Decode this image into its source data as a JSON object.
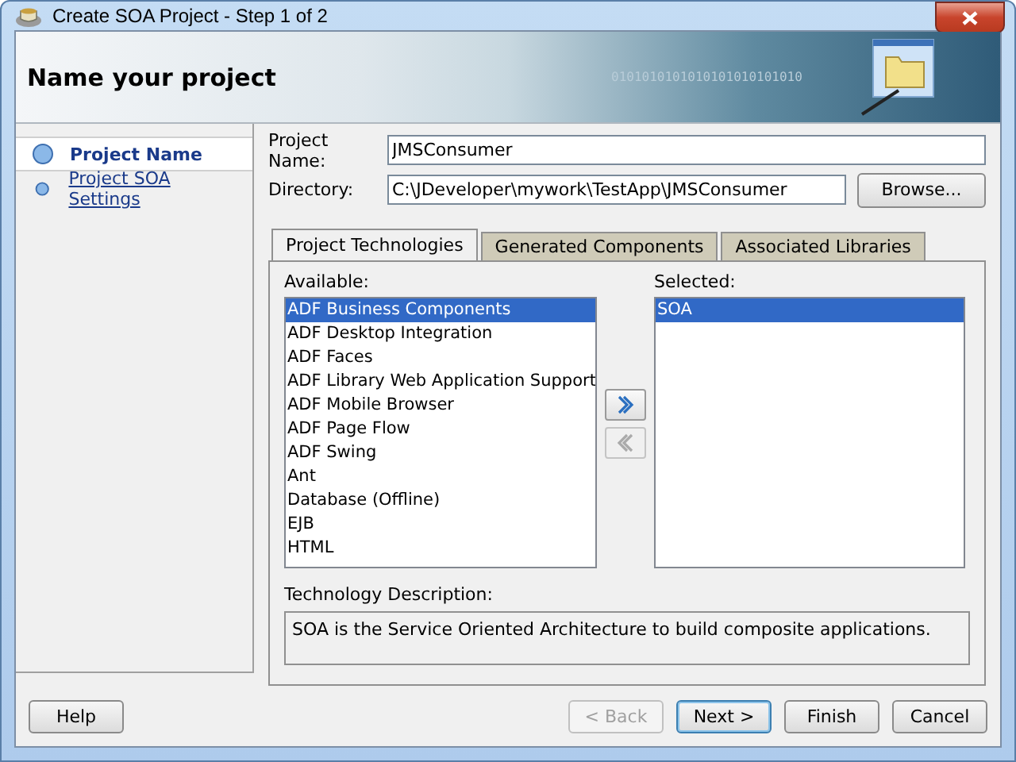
{
  "window": {
    "title": "Create SOA Project - Step 1 of 2"
  },
  "header": {
    "title": "Name your project",
    "banner_text": "0101010101010101010101010"
  },
  "steps": [
    {
      "label": "Project Name",
      "selected": true
    },
    {
      "label": "Project SOA Settings",
      "selected": false
    }
  ],
  "fields": [
    {
      "label": "Project Name:",
      "value": "JMSConsumer"
    },
    {
      "label": "Directory:",
      "value": "C:\\JDeveloper\\mywork\\TestApp\\JMSConsumer",
      "button": "Browse..."
    }
  ],
  "tabs": [
    {
      "label": "Project Technologies",
      "selected": true
    },
    {
      "label": "Generated Components",
      "selected": false
    },
    {
      "label": "Associated Libraries",
      "selected": false
    }
  ],
  "available": {
    "label": "Available:",
    "items": [
      {
        "label": "ADF Business Components",
        "selected": true
      },
      {
        "label": "ADF Desktop Integration",
        "selected": false
      },
      {
        "label": "ADF Faces",
        "selected": false
      },
      {
        "label": "ADF Library Web Application Support",
        "selected": false
      },
      {
        "label": "ADF Mobile Browser",
        "selected": false
      },
      {
        "label": "ADF Page Flow",
        "selected": false
      },
      {
        "label": "ADF Swing",
        "selected": false
      },
      {
        "label": "Ant",
        "selected": false
      },
      {
        "label": "Database (Offline)",
        "selected": false
      },
      {
        "label": "EJB",
        "selected": false
      },
      {
        "label": "HTML",
        "selected": false
      }
    ]
  },
  "move_buttons": [
    {
      "kind": "add",
      "disabled": false
    },
    {
      "kind": "remove",
      "disabled": true
    }
  ],
  "selected_list": {
    "label": "Selected:",
    "items": [
      {
        "label": "SOA",
        "selected": true
      }
    ]
  },
  "description": {
    "label": "Technology Description:",
    "text": "SOA is the Service Oriented Architecture to build composite applications."
  },
  "buttons": [
    {
      "label": "Help",
      "disabled": false,
      "default": false
    },
    {
      "label": "< Back",
      "disabled": true,
      "default": false
    },
    {
      "label": "Next >",
      "disabled": false,
      "default": true
    },
    {
      "label": "Finish",
      "disabled": false,
      "default": false
    },
    {
      "label": "Cancel",
      "disabled": false,
      "default": false
    }
  ]
}
